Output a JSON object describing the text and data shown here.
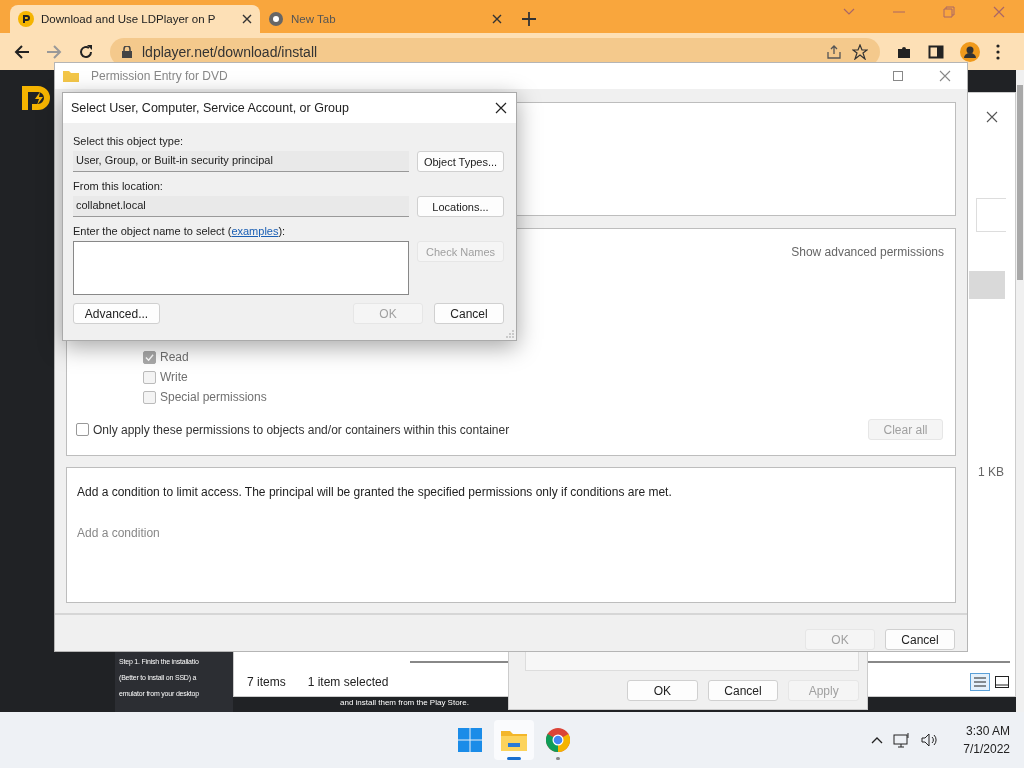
{
  "browser": {
    "tabs": [
      {
        "title": "Download and Use LDPlayer on P",
        "selected": true
      },
      {
        "title": "New Tab",
        "selected": false
      }
    ],
    "url": "ldplayer.net/download/install"
  },
  "web_page": {
    "lines": [
      "Step 1. Finish the installatio",
      "(Better to install on SSD) a",
      "emulator from your desktop"
    ],
    "caption": "and install them from the Play Store."
  },
  "explorer": {
    "size": "1 KB",
    "item_count": "7 items",
    "selection": "1 item selected"
  },
  "properties_dialog": {
    "buttons": [
      {
        "label": "OK",
        "disabled": false
      },
      {
        "label": "Cancel",
        "disabled": false
      },
      {
        "label": "Apply",
        "disabled": true
      }
    ]
  },
  "permission_entry": {
    "title": "Permission Entry for DVD",
    "show_advanced": "Show advanced permissions",
    "permissions": [
      {
        "label": "Read",
        "checked": true,
        "disabled": true
      },
      {
        "label": "Write",
        "checked": false,
        "disabled": true
      },
      {
        "label": "Special permissions",
        "checked": false,
        "disabled": true
      }
    ],
    "only_apply": {
      "label": "Only apply these permissions to objects and/or containers within this container",
      "checked": false
    },
    "clear_all": {
      "label": "Clear all",
      "disabled": true
    },
    "condition_text": "Add a condition to limit access. The principal will be granted the specified permissions only if conditions are met.",
    "add_condition": "Add a condition",
    "buttons": [
      {
        "label": "OK",
        "disabled": true
      },
      {
        "label": "Cancel",
        "disabled": false
      }
    ]
  },
  "select_dialog": {
    "title": "Select User, Computer, Service Account, or Group",
    "object_type_label": "Select this object type:",
    "object_type": "User, Group, or Built-in security principal",
    "object_types_button": "Object Types...",
    "location_label": "From this location:",
    "location": "collabnet.local",
    "locations_button": "Locations...",
    "name_label": {
      "before": "Enter the object name to select (",
      "link": "examples",
      "after": "):"
    },
    "check_names": {
      "label": "Check Names",
      "disabled": true
    },
    "advanced_button": "Advanced...",
    "buttons": [
      {
        "label": "OK",
        "disabled": true
      },
      {
        "label": "Cancel",
        "disabled": false
      }
    ]
  },
  "taskbar": {
    "apps": [
      {
        "kind": "start",
        "active": false
      },
      {
        "kind": "explorer",
        "active": true
      },
      {
        "kind": "chrome",
        "active": false
      }
    ],
    "time": "3:30 AM",
    "date": "7/1/2022"
  }
}
